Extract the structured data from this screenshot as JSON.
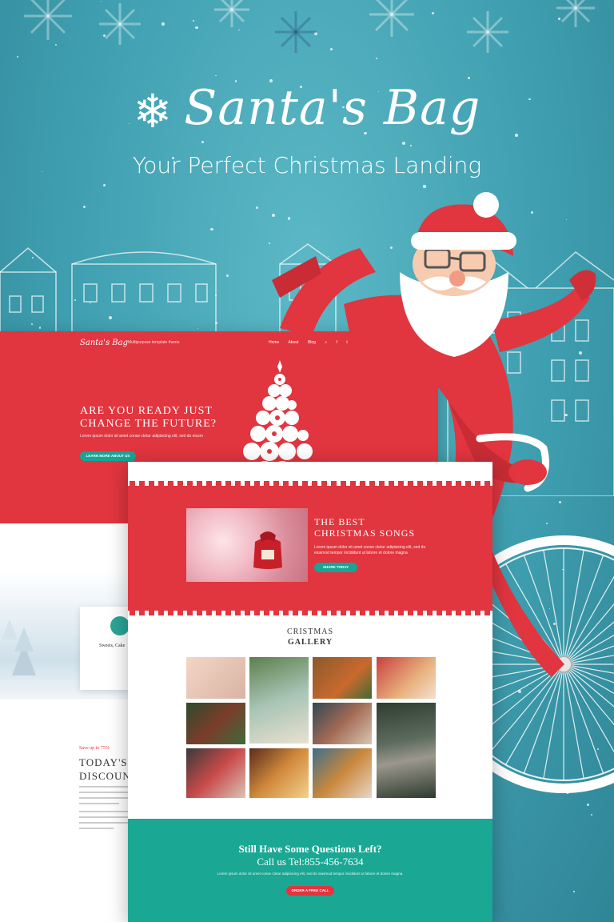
{
  "hero": {
    "title": "Santa's Bag",
    "subtitle": "Your Perfect Christmas Landing"
  },
  "back_screen": {
    "nav": {
      "logo": "Santa's Bag",
      "tagline": "Multipurpose template theme",
      "menu": [
        "Home",
        "About",
        "Blog"
      ]
    },
    "hero_heading_line1": "ARE YOU READY JUST",
    "hero_heading_line2": "CHANGE THE FUTURE?",
    "hero_text": "Lorem ipsum dolor sit amet conse ctetur adipisicing elit, sed do eiusm",
    "hero_button": "LEARN MORE ABOUT US",
    "card_title": "Sweets, Cake",
    "discount_label": "Save up to 75%",
    "discount_line1": "TODAY'S",
    "discount_line2": "DISCOUN"
  },
  "front_screen": {
    "songs_line1": "THE BEST",
    "songs_line2": "CHRISTMAS SONGS",
    "songs_text": "Lorem ipsum dolor sit amet conse ctetur adipisicing elit, sed do eiusmod tempor incididunt ut labore et dolore magna",
    "songs_button": "SHARE TODAY",
    "gallery_line1": "CRISTMAS",
    "gallery_line2": "GALLERY",
    "questions_title": "Still Have Some Questions Left?",
    "call_text": "Call us Tel:855-456-7634",
    "questions_text": "Lorem ipsum dolor sit amet conse ctetur adipisicing elit, sed do eiusmod tempor incididunt ut labore et dolore magna.",
    "call_button": "ORDER A FREE CALL"
  },
  "colors": {
    "accent_red": "#e1353f",
    "accent_teal": "#1aa794",
    "background_blue": "#4aa9b9"
  }
}
